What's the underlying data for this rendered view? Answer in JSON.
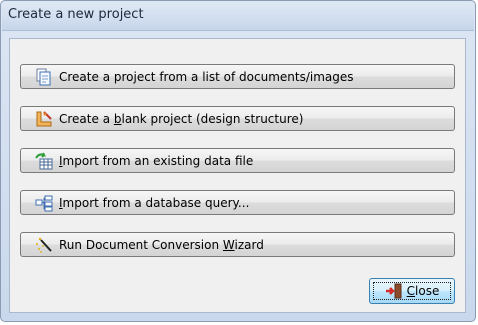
{
  "dialog": {
    "title": "Create a new project"
  },
  "buttons": [
    {
      "icon": "documents-icon",
      "pre": "Create a project from a list of documents/images",
      "acc": "",
      "post": ""
    },
    {
      "icon": "design-ruler-icon",
      "pre": "Create a ",
      "acc": "b",
      "post": "lank project (design structure)"
    },
    {
      "icon": "table-import-icon",
      "pre": "",
      "acc": "I",
      "post": "mport from an existing data file"
    },
    {
      "icon": "database-query-icon",
      "pre": "",
      "acc": "I",
      "post": "mport from a database query..."
    },
    {
      "icon": "wizard-wand-icon",
      "pre": "Run Document Conversion ",
      "acc": "W",
      "post": "izard"
    }
  ],
  "close": {
    "icon": "exit-door-icon",
    "pre": "",
    "acc": "C",
    "post": "lose"
  }
}
